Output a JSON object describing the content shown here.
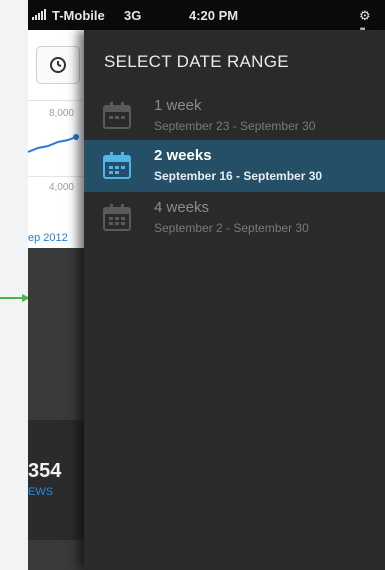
{
  "status_bar": {
    "signal_icon": "signal-bars-icon",
    "carrier": "T-Mobile",
    "network": "3G",
    "time": "4:20 PM",
    "right_icons": "⚙ ▮"
  },
  "behind_screen": {
    "clock_icon": "clock-icon",
    "y_axis": [
      "8,000",
      "4,000"
    ],
    "date_fragment": "ep 2012",
    "stat_value": "354",
    "stat_label": "EWS"
  },
  "drawer": {
    "title": "SELECT DATE RANGE",
    "options": [
      {
        "label": "1 week",
        "range": "September 23 - September 30",
        "selected": false,
        "icon": "calendar-icon"
      },
      {
        "label": "2 weeks",
        "range": "September 16 - September 30",
        "selected": true,
        "icon": "calendar-icon"
      },
      {
        "label": "4 weeks",
        "range": "September 2 - September 30",
        "selected": false,
        "icon": "calendar-icon"
      }
    ]
  },
  "colors": {
    "selected_row": "#244f66",
    "drawer_bg": "#2a2a2a",
    "accent_blue": "#2a7bd6",
    "annotation_green": "#49b649"
  }
}
